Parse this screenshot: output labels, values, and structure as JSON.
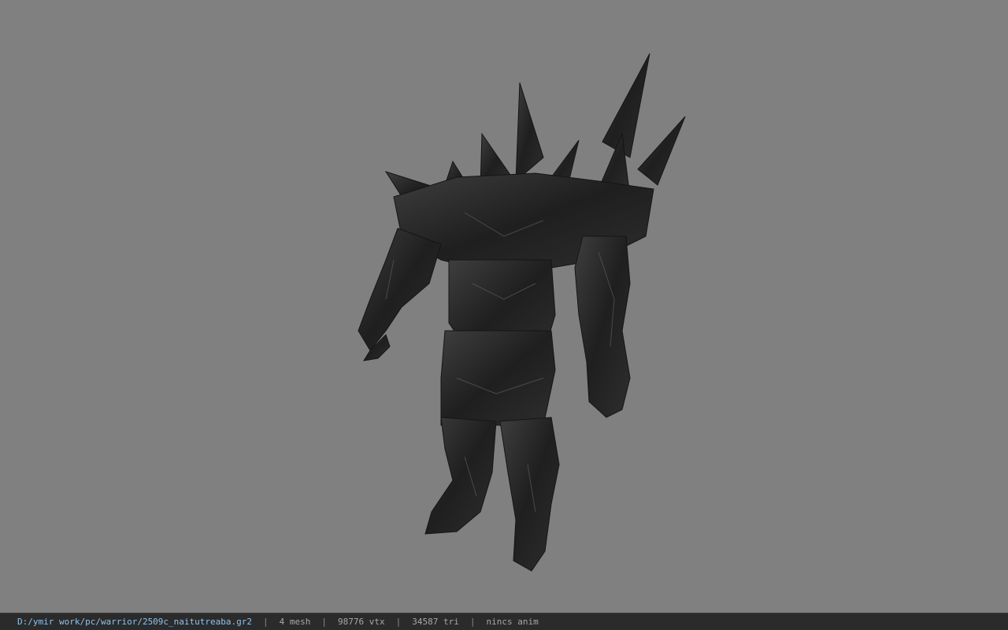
{
  "viewport": {
    "background": "#808080",
    "model": "spiked dark armored warrior (3D preview)"
  },
  "statusbar": {
    "file_path": "D:/ymir work/pc/warrior/2509c_naitutreaba.gr2",
    "separator": "|",
    "mesh": "4 mesh",
    "vertices": "98776 vtx",
    "triangles": "34587 tri",
    "anim": "nincs anim"
  }
}
